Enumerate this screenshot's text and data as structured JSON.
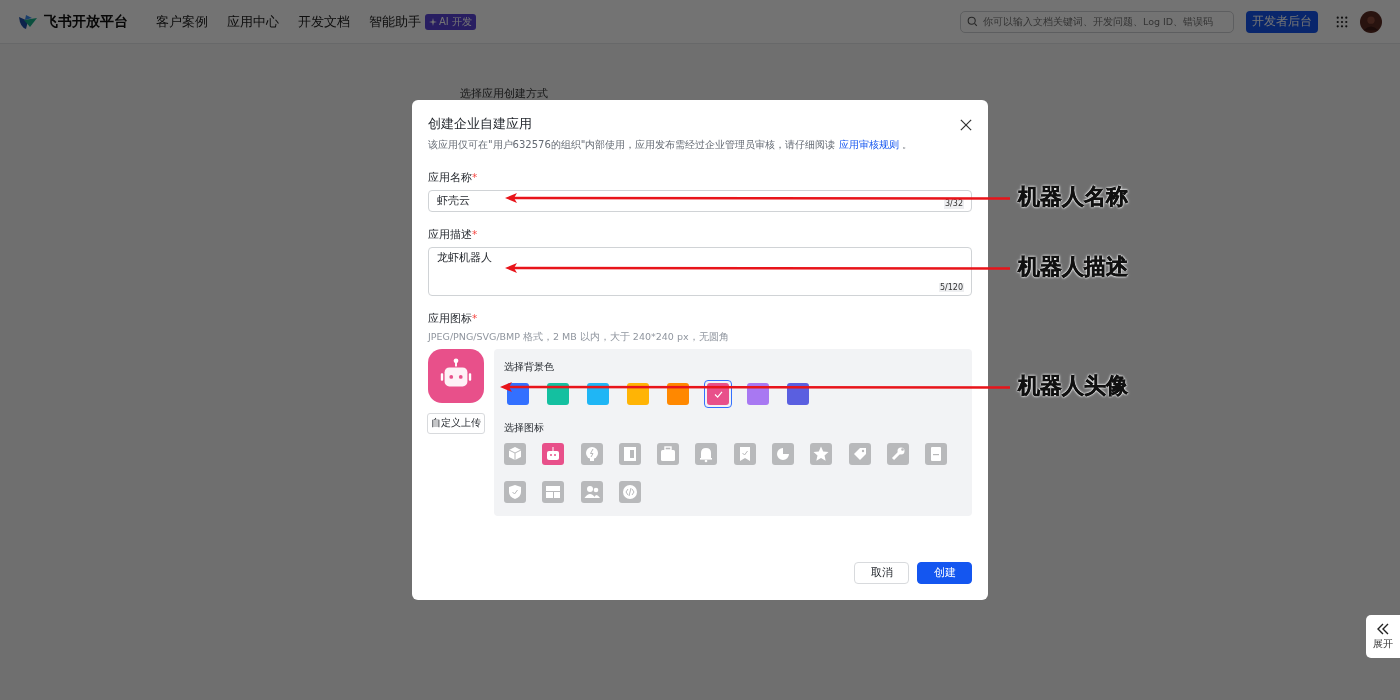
{
  "nav": {
    "logo": "飞书开放平台",
    "links": [
      "客户案例",
      "应用中心",
      "开发文档",
      "智能助手"
    ],
    "ai_badge": "AI 开发",
    "search": {
      "placeholder": "你可以输入文档关键词、开发问题、Log ID、错误码"
    },
    "console_button": "开发者后台"
  },
  "background_text": "选择应用创建方式",
  "dialog": {
    "title": "创建企业自建应用",
    "notice": "该应用仅可在\"用户632576的组织\"内部使用，应用发布需经过企业管理员审核，请仔细阅读",
    "notice_link": "应用审核规则",
    "notice_end": "。",
    "name_field": {
      "label": "应用名称",
      "mark": "*",
      "value": "虾壳云",
      "counter": "3/32"
    },
    "desc_field": {
      "label": "应用描述",
      "mark": "*",
      "value": "龙虾机器人",
      "counter": "5/120"
    },
    "icon_field": {
      "label": "应用图标",
      "mark": "*",
      "hint": "JPEG/PNG/SVG/BMP 格式，2 MB 以内，大于 240*240 px，无圆角",
      "upload_button": "自定义上传"
    },
    "color_title": "选择背景色",
    "colors": [
      {
        "color": "#3370ff",
        "selected": false
      },
      {
        "color": "#14c0a0",
        "selected": false
      },
      {
        "color": "#1fb6f5",
        "selected": false
      },
      {
        "color": "#ffb405",
        "selected": false
      },
      {
        "color": "#ff8800",
        "selected": false
      },
      {
        "color": "#e8508a",
        "selected": true
      },
      {
        "color": "#a878f2",
        "selected": false
      },
      {
        "color": "#5a5fe0",
        "selected": false
      }
    ],
    "icon_title": "选择图标",
    "icons": [
      {
        "selected": false
      },
      {
        "selected": true
      },
      {
        "selected": false
      },
      {
        "selected": false
      },
      {
        "selected": false
      },
      {
        "selected": false
      },
      {
        "selected": false
      },
      {
        "selected": false
      },
      {
        "selected": false
      },
      {
        "selected": false
      },
      {
        "selected": false
      },
      {
        "selected": false
      },
      {
        "selected": false
      },
      {
        "selected": false
      },
      {
        "selected": false
      },
      {
        "selected": false
      }
    ],
    "cancel_button": "取消",
    "create_button": "创建"
  },
  "expand_button": "展开",
  "annotations": [
    {
      "text": "机器人名称"
    },
    {
      "text": "机器人描述"
    },
    {
      "text": "机器人头像"
    }
  ]
}
